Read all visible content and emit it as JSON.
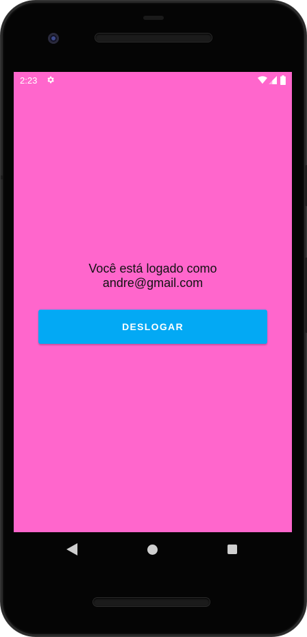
{
  "status_bar": {
    "time": "2:23",
    "icons": [
      "settings-gear-icon",
      "wifi-icon",
      "cell-signal-icon",
      "battery-icon"
    ]
  },
  "main": {
    "logged_in_text": "Você está logado como\nandre@gmail.com",
    "logout_button_label": "DESLOGAR"
  },
  "nav_bar": {
    "icons": [
      "back-icon",
      "home-icon",
      "recent-apps-icon"
    ]
  },
  "colors": {
    "screen_background": "#ff66cc",
    "button_background": "#03a9f4",
    "button_text": "#ffffff",
    "body_text": "#111111"
  }
}
